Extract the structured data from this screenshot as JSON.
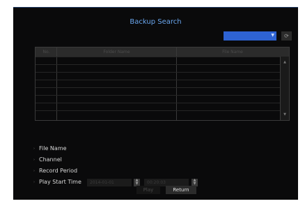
{
  "title": "Backup Search",
  "device_select": {
    "value": ""
  },
  "table": {
    "columns": [
      "No.",
      "Folder Name",
      "File Name"
    ],
    "rows": []
  },
  "options": [
    {
      "label": "File Name"
    },
    {
      "label": "Channel"
    },
    {
      "label": "Record Period"
    },
    {
      "label": "Play Start Time"
    }
  ],
  "play_start": {
    "date": "2014-01-01",
    "time": "00:20:03"
  },
  "buttons": {
    "play": "Play",
    "return": "Return"
  },
  "icons": {
    "refresh": "refresh-icon",
    "dropdown": "chevron-down-icon"
  },
  "colors": {
    "accent": "#2e63d3",
    "title": "#6aa6ee",
    "panel": "#0a0a0b"
  }
}
